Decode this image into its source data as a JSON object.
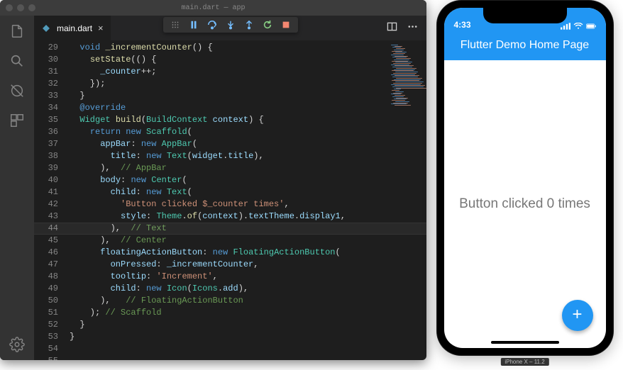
{
  "vscode": {
    "title": "main.dart — app",
    "tab": {
      "filename": "main.dart",
      "close_glyph": "×"
    },
    "debug_toolbar": {
      "grip": "grip-icon",
      "pause": "pause-icon",
      "step_over": "step-over-icon",
      "step_into": "step-into-icon",
      "step_out": "step-out-icon",
      "restart": "restart-icon",
      "stop": "stop-icon"
    },
    "gutter_start": 29,
    "gutter_end": 55,
    "cursor_line": 44,
    "code_lines": [
      [
        [
          "pun",
          ""
        ]
      ],
      [
        [
          "pun",
          "  "
        ],
        [
          "kw",
          "void"
        ],
        [
          "pun",
          " "
        ],
        [
          "fn",
          "_incrementCounter"
        ],
        [
          "pun",
          "() {"
        ]
      ],
      [
        [
          "pun",
          "    "
        ],
        [
          "fn",
          "setState"
        ],
        [
          "pun",
          "(() {"
        ]
      ],
      [
        [
          "pun",
          "      "
        ],
        [
          "id",
          "_counter"
        ],
        [
          "op",
          "++"
        ],
        [
          "pun",
          ";"
        ]
      ],
      [
        [
          "pun",
          "    });"
        ]
      ],
      [
        [
          "pun",
          "  }"
        ]
      ],
      [
        [
          "pun",
          ""
        ]
      ],
      [
        [
          "pun",
          "  "
        ],
        [
          "ann",
          "@override"
        ]
      ],
      [
        [
          "pun",
          "  "
        ],
        [
          "type",
          "Widget"
        ],
        [
          "pun",
          " "
        ],
        [
          "fn",
          "build"
        ],
        [
          "pun",
          "("
        ],
        [
          "type",
          "BuildContext"
        ],
        [
          "pun",
          " "
        ],
        [
          "id",
          "context"
        ],
        [
          "pun",
          ") {"
        ]
      ],
      [
        [
          "pun",
          "    "
        ],
        [
          "kw",
          "return"
        ],
        [
          "pun",
          " "
        ],
        [
          "kw",
          "new"
        ],
        [
          "pun",
          " "
        ],
        [
          "type",
          "Scaffold"
        ],
        [
          "pun",
          "("
        ]
      ],
      [
        [
          "pun",
          "      "
        ],
        [
          "id",
          "appBar"
        ],
        [
          "pun",
          ": "
        ],
        [
          "kw",
          "new"
        ],
        [
          "pun",
          " "
        ],
        [
          "type",
          "AppBar"
        ],
        [
          "pun",
          "("
        ]
      ],
      [
        [
          "pun",
          "        "
        ],
        [
          "id",
          "title"
        ],
        [
          "pun",
          ": "
        ],
        [
          "kw",
          "new"
        ],
        [
          "pun",
          " "
        ],
        [
          "type",
          "Text"
        ],
        [
          "pun",
          "("
        ],
        [
          "id",
          "widget"
        ],
        [
          "pun",
          "."
        ],
        [
          "id",
          "title"
        ],
        [
          "pun",
          "),"
        ]
      ],
      [
        [
          "pun",
          "      ),  "
        ],
        [
          "cmt",
          "// AppBar"
        ]
      ],
      [
        [
          "pun",
          "      "
        ],
        [
          "id",
          "body"
        ],
        [
          "pun",
          ": "
        ],
        [
          "kw",
          "new"
        ],
        [
          "pun",
          " "
        ],
        [
          "type",
          "Center"
        ],
        [
          "pun",
          "("
        ]
      ],
      [
        [
          "pun",
          "        "
        ],
        [
          "id",
          "child"
        ],
        [
          "pun",
          ": "
        ],
        [
          "kw",
          "new"
        ],
        [
          "pun",
          " "
        ],
        [
          "type",
          "Text"
        ],
        [
          "pun",
          "("
        ]
      ],
      [
        [
          "pun",
          "          "
        ],
        [
          "str",
          "'Button clicked $_counter times'"
        ],
        [
          "pun",
          ","
        ]
      ],
      [
        [
          "pun",
          "          "
        ],
        [
          "id",
          "style"
        ],
        [
          "pun",
          ": "
        ],
        [
          "type",
          "Theme"
        ],
        [
          "pun",
          "."
        ],
        [
          "fn",
          "of"
        ],
        [
          "pun",
          "("
        ],
        [
          "id",
          "context"
        ],
        [
          "pun",
          ")."
        ],
        [
          "id",
          "textTheme"
        ],
        [
          "pun",
          "."
        ],
        [
          "id",
          "display1"
        ],
        [
          "pun",
          ","
        ]
      ],
      [
        [
          "pun",
          "        ),  "
        ],
        [
          "cmt",
          "// Text"
        ]
      ],
      [
        [
          "pun",
          "      ),  "
        ],
        [
          "cmt",
          "// Center"
        ]
      ],
      [
        [
          "pun",
          "      "
        ],
        [
          "id",
          "floatingActionButton"
        ],
        [
          "pun",
          ": "
        ],
        [
          "kw",
          "new"
        ],
        [
          "pun",
          " "
        ],
        [
          "type",
          "FloatingActionButton"
        ],
        [
          "pun",
          "("
        ]
      ],
      [
        [
          "pun",
          "        "
        ],
        [
          "id",
          "onPressed"
        ],
        [
          "pun",
          ": "
        ],
        [
          "id",
          "_incrementCounter"
        ],
        [
          "pun",
          ","
        ]
      ],
      [
        [
          "pun",
          "        "
        ],
        [
          "id",
          "tooltip"
        ],
        [
          "pun",
          ": "
        ],
        [
          "str",
          "'Increment'"
        ],
        [
          "pun",
          ","
        ]
      ],
      [
        [
          "pun",
          "        "
        ],
        [
          "id",
          "child"
        ],
        [
          "pun",
          ": "
        ],
        [
          "kw",
          "new"
        ],
        [
          "pun",
          " "
        ],
        [
          "type",
          "Icon"
        ],
        [
          "pun",
          "("
        ],
        [
          "type",
          "Icons"
        ],
        [
          "pun",
          "."
        ],
        [
          "id",
          "add"
        ],
        [
          "pun",
          "),"
        ]
      ],
      [
        [
          "pun",
          "      ),   "
        ],
        [
          "cmt",
          "// FloatingActionButton"
        ]
      ],
      [
        [
          "pun",
          "    ); "
        ],
        [
          "cmt",
          "// Scaffold"
        ]
      ],
      [
        [
          "pun",
          "  }"
        ]
      ],
      [
        [
          "pun",
          "}"
        ]
      ]
    ]
  },
  "phone": {
    "statusbar_time": "4:33",
    "appbar_title": "Flutter Demo Home Page",
    "body_text": "Button clicked 0 times",
    "fab_icon": "+",
    "sim_label": "iPhone X – 11.2"
  },
  "colors": {
    "vscode_bg": "#1e1e1e",
    "flutter_blue": "#2196F3"
  }
}
